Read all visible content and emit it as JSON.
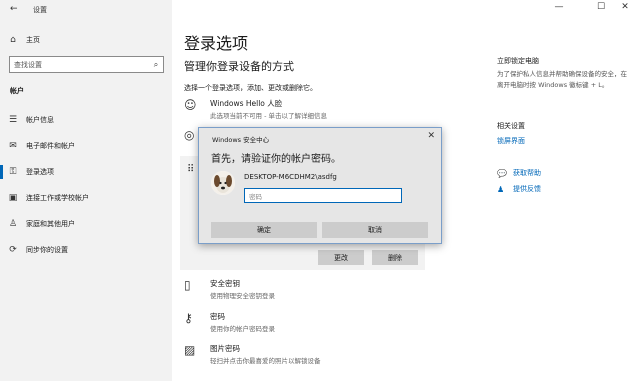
{
  "window": {
    "title": "设置"
  },
  "nav": {
    "home": "主页",
    "search_placeholder": "查找设置",
    "section": "帐户",
    "items": [
      {
        "label": "帐户信息",
        "icon": "person-card-icon"
      },
      {
        "label": "电子邮件和帐户",
        "icon": "mail-icon"
      },
      {
        "label": "登录选项",
        "icon": "key-icon"
      },
      {
        "label": "连接工作或学校帐户",
        "icon": "briefcase-icon"
      },
      {
        "label": "家庭和其他用户",
        "icon": "family-icon"
      },
      {
        "label": "同步你的设置",
        "icon": "sync-icon"
      }
    ]
  },
  "main": {
    "title": "登录选项",
    "subtitle": "管理你登录设备的方式",
    "instruction": "选择一个登录选项，添加、更改或删除它。",
    "options": [
      {
        "name": "Windows Hello 人脸",
        "desc": "此选项当前不可用 - 单击以了解详细信息"
      },
      {
        "name": "安全密钥",
        "desc": "使用物理安全密钥登录"
      },
      {
        "name": "密码",
        "desc": "使用你的帐户密码登录"
      },
      {
        "name": "图片密码",
        "desc": "轻扫并点击你最喜爱的照片以解锁设备"
      }
    ],
    "change_button": "更改",
    "remove_button": "删除"
  },
  "right": {
    "lock_heading": "立即锁定电脑",
    "lock_text": "为了保护私人信息并帮助确保设备的安全，在离开电脑时按 Windows 徽标键 + L。",
    "related_heading": "相关设置",
    "related_link": "锁屏界面",
    "help_link": "获取帮助",
    "feedback_link": "提供反馈"
  },
  "dialog": {
    "title": "Windows 安全中心",
    "heading": "首先，请验证你的帐户密码。",
    "user": "DESKTOP-M6CDHM2\\asdfg",
    "password_placeholder": "密码",
    "ok": "确定",
    "cancel": "取消"
  },
  "colors": {
    "accent": "#0067b8",
    "nav_bg": "#f2f2f2",
    "dialog_bg": "#e6e6e6"
  }
}
